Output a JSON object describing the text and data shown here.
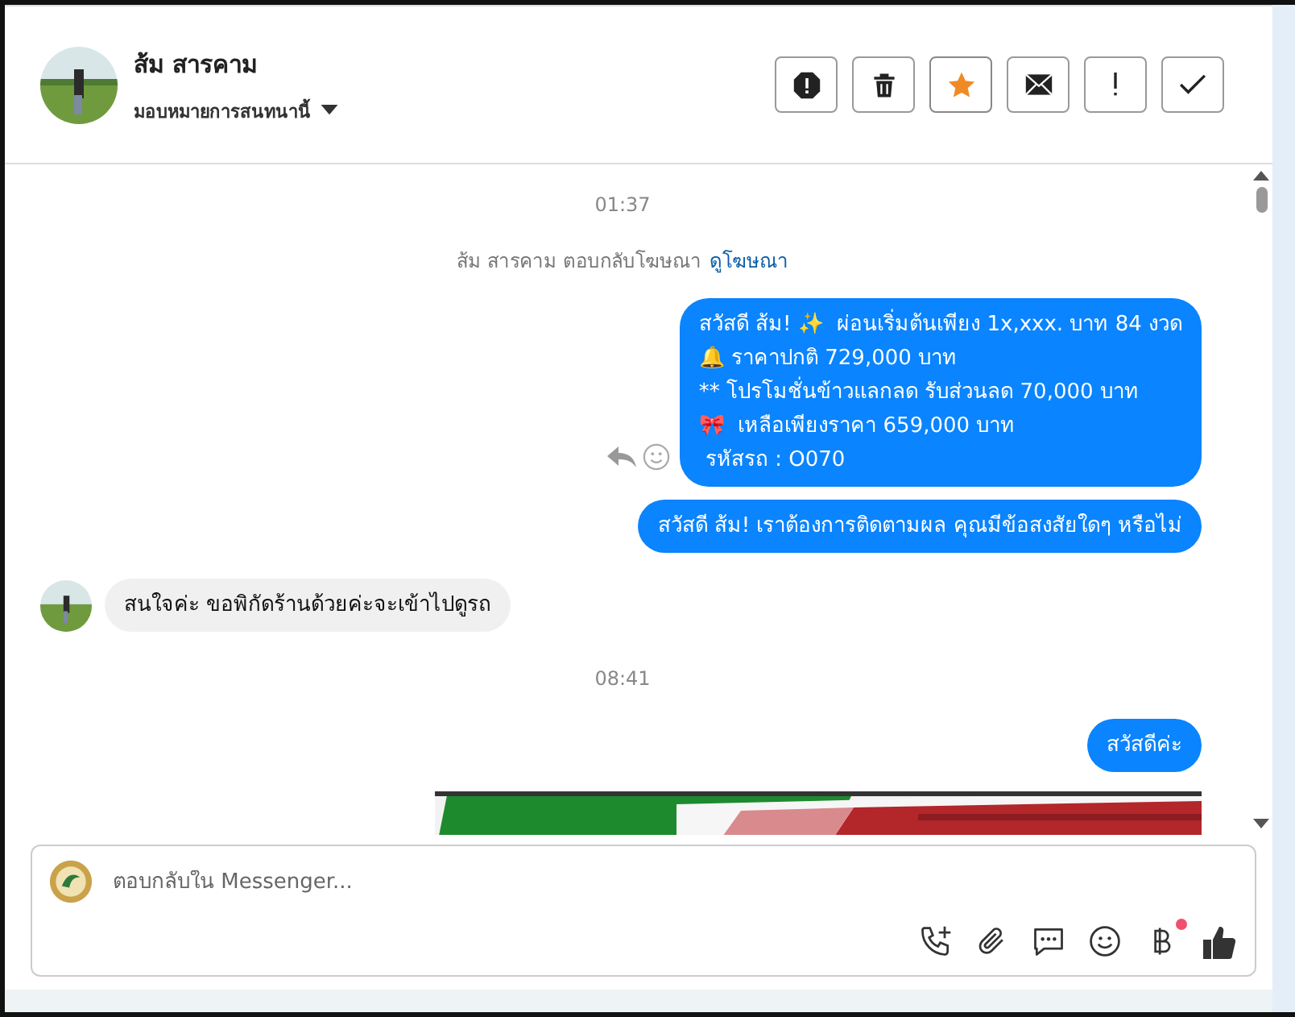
{
  "header": {
    "contact_name": "ส้ม สารคาม",
    "assign_label": "มอบหมายการสนทนานี้",
    "actions": [
      {
        "kind": "spam",
        "selected": false
      },
      {
        "kind": "delete",
        "selected": false
      },
      {
        "kind": "star",
        "selected": true
      },
      {
        "kind": "mail",
        "selected": false
      },
      {
        "kind": "important",
        "selected": false
      },
      {
        "kind": "done",
        "selected": false
      }
    ]
  },
  "messages": [
    {
      "kind": "timestamp",
      "text": "01:37"
    },
    {
      "kind": "ad_reply",
      "text": "ส้ม สารคาม ตอบกลับโฆษณา",
      "link": "ดูโฆษณา"
    },
    {
      "kind": "outgoing",
      "text": "สวัสดี ส้ม! ✨  ผ่อนเริ่มต้นเพียง 1x,xxx. บาท 84 งวด\n🔔 ราคาปกติ 729,000 บาท\n** โปรโมชั่นข้าวแลกลด รับส่วนลด 70,000 บาท\n🎀  เหลือเพียงราคา 659,000 บาท\n รหัสรถ : O070",
      "hover_actions": true
    },
    {
      "kind": "outgoing",
      "text": "สวัสดี ส้ม! เราต้องการติดตามผล คุณมีข้อสงสัยใดๆ หรือไม่",
      "hover_actions": false
    },
    {
      "kind": "incoming",
      "text": "สนใจค่ะ ขอพิกัดร้านด้วยค่ะจะเข้าไปดูรถ"
    },
    {
      "kind": "timestamp",
      "text": "08:41"
    },
    {
      "kind": "outgoing",
      "text": "สวัสดีค่ะ",
      "hover_actions": false
    },
    {
      "kind": "picture"
    }
  ],
  "composer": {
    "placeholder": "ตอบกลับใน Messenger...",
    "tools": [
      {
        "kind": "call",
        "badge": false
      },
      {
        "kind": "attach",
        "badge": false
      },
      {
        "kind": "saved_reply",
        "badge": false
      },
      {
        "kind": "emoji",
        "badge": false
      },
      {
        "kind": "payment",
        "badge": true
      },
      {
        "kind": "like",
        "badge": false
      }
    ]
  }
}
